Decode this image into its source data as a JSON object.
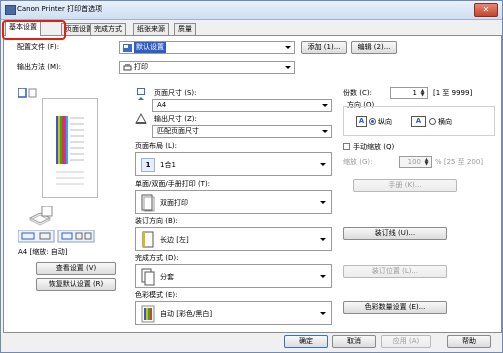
{
  "window": {
    "title": "Canon Printer 打印首选项",
    "close": "✕"
  },
  "tabs": [
    {
      "label": "基本设置"
    },
    {
      "label": "页面设置"
    },
    {
      "label": "完成方式"
    },
    {
      "label": "纸张来源"
    },
    {
      "label": "质量"
    }
  ],
  "profile": {
    "label": "配置文件 (F):",
    "value": "默认设置",
    "add_btn": "添加 (1)...",
    "edit_btn": "编辑 (2)..."
  },
  "output": {
    "label": "输出方法 (M):",
    "value": "打印"
  },
  "preview": {
    "status": "A4 [缩放: 自动]",
    "view_settings_btn": "查看设置 (V)",
    "restore_defaults_btn": "恢复默认设置 (R)"
  },
  "page_size": {
    "label": "页面尺寸 (S):",
    "value": "A4"
  },
  "output_size": {
    "label": "输出尺寸 (Z):",
    "value": "匹配页面尺寸"
  },
  "copies": {
    "label": "份数 (C):",
    "value": "1",
    "range": "[1 至 9999]"
  },
  "orientation": {
    "label": "方向 (O)",
    "portrait": "纵向",
    "landscape": "横向",
    "letter": "A",
    "selected": "portrait"
  },
  "layout": {
    "label": "页面布局 (L):",
    "value": "1合1",
    "badge": "1"
  },
  "manual_scale": {
    "label": "手动缩放 (Q)",
    "checked": false,
    "scale_label": "缩放 (G):",
    "scale_value": "100",
    "scale_range": "% [25 至 200]"
  },
  "duplex": {
    "label": "单面/双面/手册打印 (T):",
    "value": "双面打印",
    "booklet_btn": "手册 (K)..."
  },
  "binding": {
    "label": "装订方向 (B):",
    "value": "长边 [左]",
    "margin_btn": "装订线 (U)..."
  },
  "finishing": {
    "label": "完成方式 (D):",
    "value": "分套",
    "staple_btn": "装订位置 (L)..."
  },
  "color": {
    "label": "色彩模式 (E):",
    "value": "自动 [彩色/黑白]",
    "quality_btn": "色彩数量设置 (E)..."
  },
  "footer": {
    "ok": "确定",
    "cancel": "取消",
    "apply": "应用 (A)",
    "help": "帮助"
  },
  "colors": {
    "accent": "#2f5ec6",
    "highlight_box": "#e22010",
    "title_bar": "#cfdef1"
  }
}
